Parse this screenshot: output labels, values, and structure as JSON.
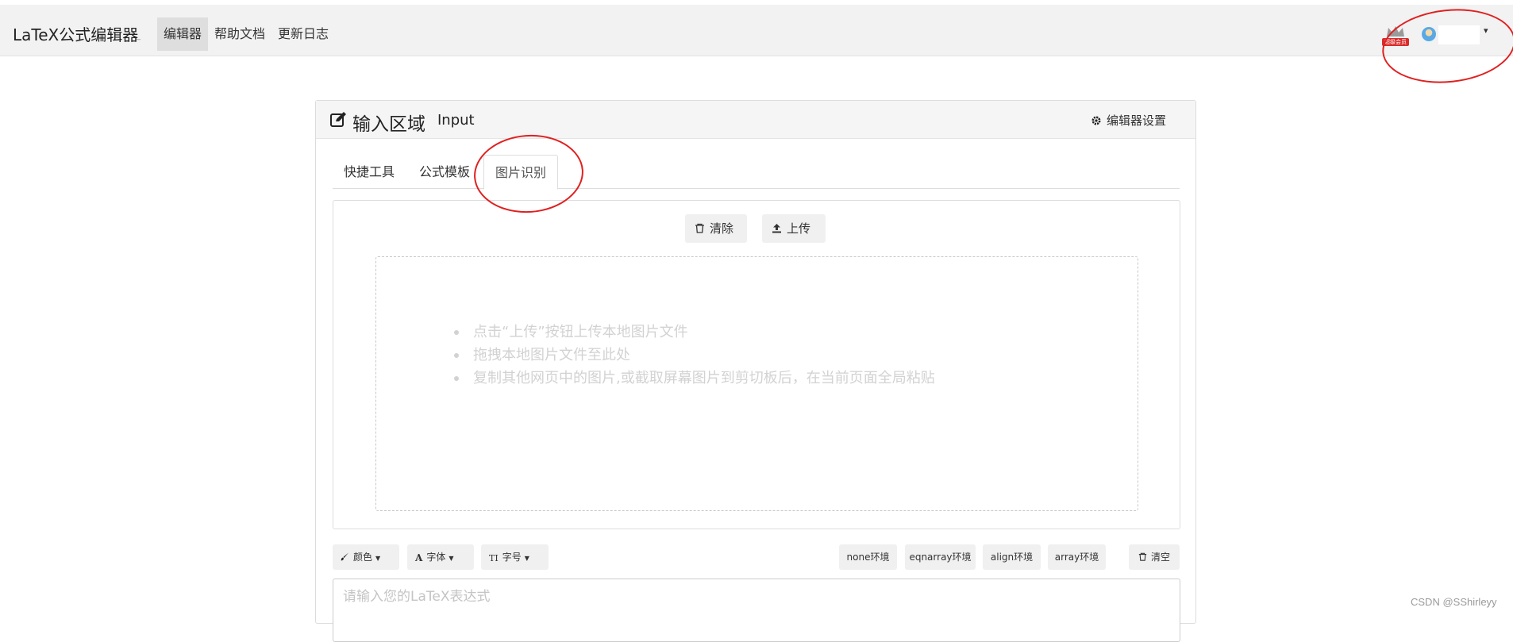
{
  "app": {
    "brand": "LaTeX公式编辑器",
    "nav": [
      {
        "label": "编辑器",
        "active": true
      },
      {
        "label": "帮助文档",
        "active": false
      },
      {
        "label": "更新日志",
        "active": false
      }
    ],
    "vip_badge": "超级会员"
  },
  "panel": {
    "title_cn": "输入区域",
    "title_en": "Input",
    "settings_label": "编辑器设置",
    "tabs": [
      {
        "label": "快捷工具",
        "active": false
      },
      {
        "label": "公式模板",
        "active": false
      },
      {
        "label": "图片识别",
        "active": true
      }
    ]
  },
  "ocr": {
    "clear_label": "清除",
    "upload_label": "上传",
    "hints": [
      "点击“上传”按钮上传本地图片文件",
      "拖拽本地图片文件至此处",
      "复制其他网页中的图片,或截取屏幕图片到剪切板后，在当前页面全局粘贴"
    ]
  },
  "toolbar": {
    "color_label": "颜色",
    "font_label": "字体",
    "size_label": "字号",
    "env_none": "none环境",
    "env_eqnarray": "eqnarray环境",
    "env_align": "align环境",
    "env_array": "array环境",
    "clear_all": "清空"
  },
  "input": {
    "placeholder": "请输入您的LaTeX表达式",
    "value": ""
  },
  "watermark": "CSDN @SShirleyy",
  "colors": {
    "annotation_red": "#e02020",
    "navbar_bg": "#f2f2f2",
    "hint_text": "#d2d2d2"
  }
}
